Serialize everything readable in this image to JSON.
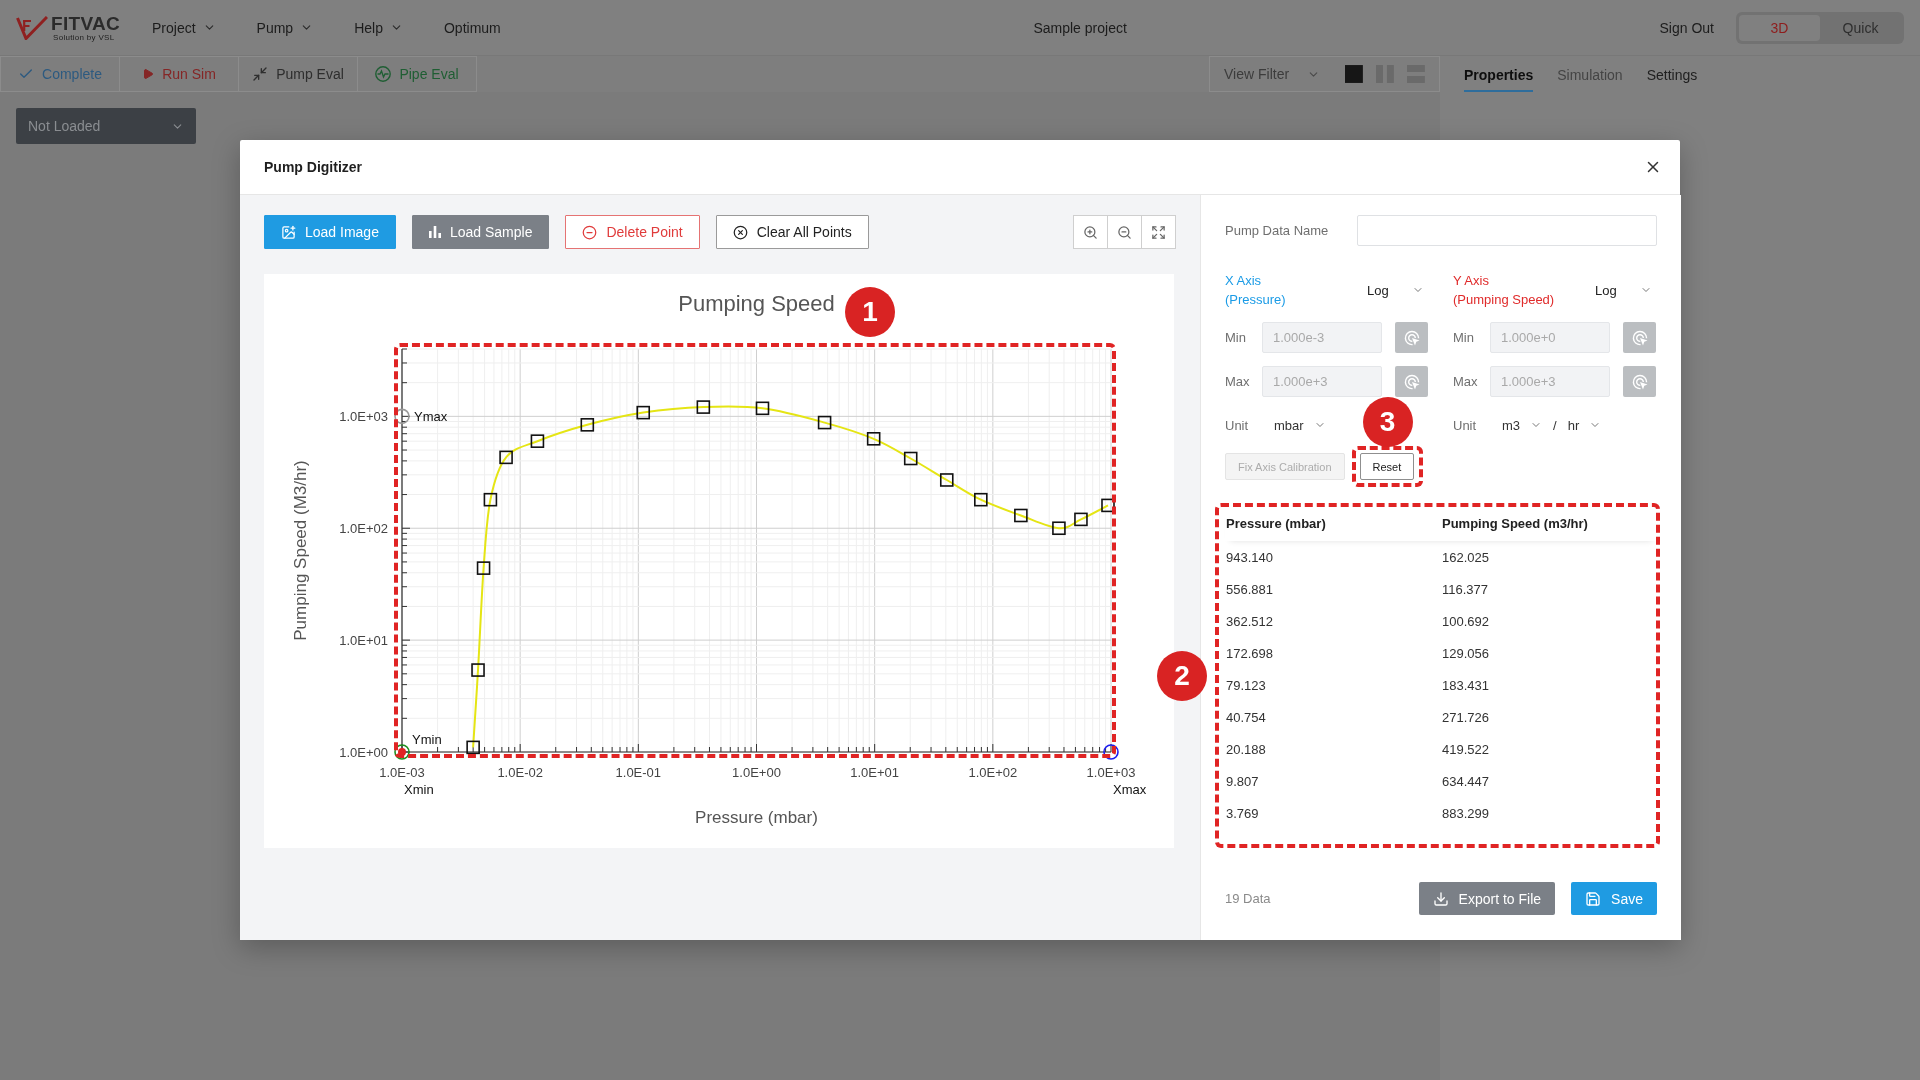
{
  "app_header": {
    "logo": {
      "wordmark": "FITVAC",
      "tagline": "Solution by VSL"
    },
    "menu": [
      {
        "label": "Project",
        "dropdown": true
      },
      {
        "label": "Pump",
        "dropdown": true
      },
      {
        "label": "Help",
        "dropdown": true
      },
      {
        "label": "Optimum",
        "dropdown": false
      }
    ],
    "project_name": "Sample project",
    "sign_out": "Sign Out",
    "view_modes": [
      {
        "label": "3D",
        "selected": true
      },
      {
        "label": "Quick",
        "selected": false
      }
    ]
  },
  "toolbar": {
    "actions": [
      {
        "label": "Complete",
        "kind": "complete"
      },
      {
        "label": "Run Sim",
        "kind": "run"
      },
      {
        "label": "Pump Eval",
        "kind": "pump"
      },
      {
        "label": "Pipe Eval",
        "kind": "pipe"
      }
    ],
    "view_filter": {
      "placeholder": "View Filter"
    },
    "layouts": [
      {
        "kind": "single",
        "selected": true
      },
      {
        "kind": "columns",
        "selected": false
      },
      {
        "kind": "rows",
        "selected": false
      }
    ]
  },
  "workspace": {
    "model_select": {
      "value": "Not Loaded"
    }
  },
  "properties_panel": {
    "tabs": [
      {
        "label": "Properties",
        "selected": true,
        "disabled": false
      },
      {
        "label": "Simulation",
        "selected": false,
        "disabled": true
      },
      {
        "label": "Settings",
        "selected": false,
        "disabled": false
      }
    ]
  },
  "dialog": {
    "title": "Pump Digitizer",
    "tools": [
      {
        "label": "Load Image",
        "kind": "image"
      },
      {
        "label": "Load Sample",
        "kind": "sample"
      },
      {
        "label": "Delete Point",
        "kind": "delete"
      },
      {
        "label": "Clear All Points",
        "kind": "clear"
      }
    ],
    "view_tools": [
      {
        "kind": "zoom_in"
      },
      {
        "kind": "zoom_out"
      },
      {
        "kind": "fit"
      }
    ],
    "chart": {
      "callout": "1",
      "chart_data": {
        "type": "line",
        "title": "Pumping Speed",
        "xlabel": "Pressure (mbar)",
        "ylabel": "Pumping Speed (M3/hr)",
        "log": "xy",
        "grid": true,
        "x": [
          0.004,
          0.0044,
          0.0049,
          0.0056,
          0.0076,
          0.014,
          0.037,
          0.11,
          0.355,
          1.124,
          3.769,
          9.807,
          20.188,
          40.754,
          79.123,
          172.698,
          362.512,
          556.881,
          943.14
        ],
        "series": [
          {
            "color": "#e5e514",
            "marker": "square",
            "values": [
              1.1,
              5.4,
              44,
              180,
              430,
              600,
              840,
              1080,
              1210,
              1180,
              880,
              630,
              420,
              270,
              180,
              130,
              100,
              120,
              160
            ]
          }
        ],
        "xlim": [
          0.001,
          1000
        ],
        "ylim": [
          1,
          4000
        ],
        "xticks": [
          {
            "value": 0.001,
            "label": "1.0E-03"
          },
          {
            "value": 0.01,
            "label": "1.0E-02"
          },
          {
            "value": 0.1,
            "label": "1.0E-01"
          },
          {
            "value": 1,
            "label": "1.0E+00"
          },
          {
            "value": 10,
            "label": "1.0E+01"
          },
          {
            "value": 100,
            "label": "1.0E+02"
          },
          {
            "value": 1000,
            "label": "1.0E+03"
          }
        ],
        "yticks": [
          {
            "value": 1,
            "label": "1.0E+00"
          },
          {
            "value": 10,
            "label": "1.0E+01"
          },
          {
            "value": 100,
            "label": "1.0E+02"
          },
          {
            "value": 1000,
            "label": "1.0E+03"
          }
        ]
      },
      "calibration_points": [
        {
          "label": "Xmin",
          "kind": "xmin",
          "color": "#1f8f1f"
        },
        {
          "label": "Ymin",
          "kind": "ymin",
          "color": "#e02424"
        },
        {
          "label": "Xmax",
          "kind": "xmax",
          "color": "#1c1cf0"
        },
        {
          "label": "Ymax",
          "kind": "ymax",
          "color": "#9a9a9a"
        }
      ]
    },
    "pump_data_name": {
      "label": "Pump Data Name"
    },
    "axes": [
      {
        "title": "X Axis",
        "subtitle": "(Pressure)",
        "color": "#1a9be6",
        "scale": "Log",
        "min": {
          "label": "Min",
          "value": "1.000e-3",
          "disabled": true
        },
        "max": {
          "label": "Max",
          "value": "1.000e+3",
          "disabled": true
        },
        "unit": {
          "label": "Unit",
          "selects": [
            "mbar"
          ]
        }
      },
      {
        "title": "Y Axis",
        "subtitle": "(Pumping Speed)",
        "color": "#e02b2b",
        "scale": "Log",
        "min": {
          "label": "Min",
          "value": "1.000e+0",
          "disabled": true
        },
        "max": {
          "label": "Max",
          "value": "1.000e+3",
          "disabled": true
        },
        "unit": {
          "label": "Unit",
          "selects": [
            "m3",
            "hr"
          ],
          "separator": "/"
        }
      }
    ],
    "calibration_actions": [
      {
        "label": "Fix Axis Calibration",
        "disabled": true
      },
      {
        "label": "Reset",
        "disabled": false,
        "callout": "3"
      }
    ],
    "table": {
      "callout": "2",
      "columns": [
        "Pressure (mbar)",
        "Pumping Speed (m3/hr)"
      ],
      "rows": [
        [
          "943.140",
          "162.025"
        ],
        [
          "556.881",
          "116.377"
        ],
        [
          "362.512",
          "100.692"
        ],
        [
          "172.698",
          "129.056"
        ],
        [
          "79.123",
          "183.431"
        ],
        [
          "40.754",
          "271.726"
        ],
        [
          "20.188",
          "419.522"
        ],
        [
          "9.807",
          "634.447"
        ],
        [
          "3.769",
          "883.299"
        ]
      ]
    },
    "count": "19 Data",
    "footer_buttons": [
      {
        "label": "Export to File",
        "kind": "export"
      },
      {
        "label": "Save",
        "kind": "save"
      }
    ]
  }
}
